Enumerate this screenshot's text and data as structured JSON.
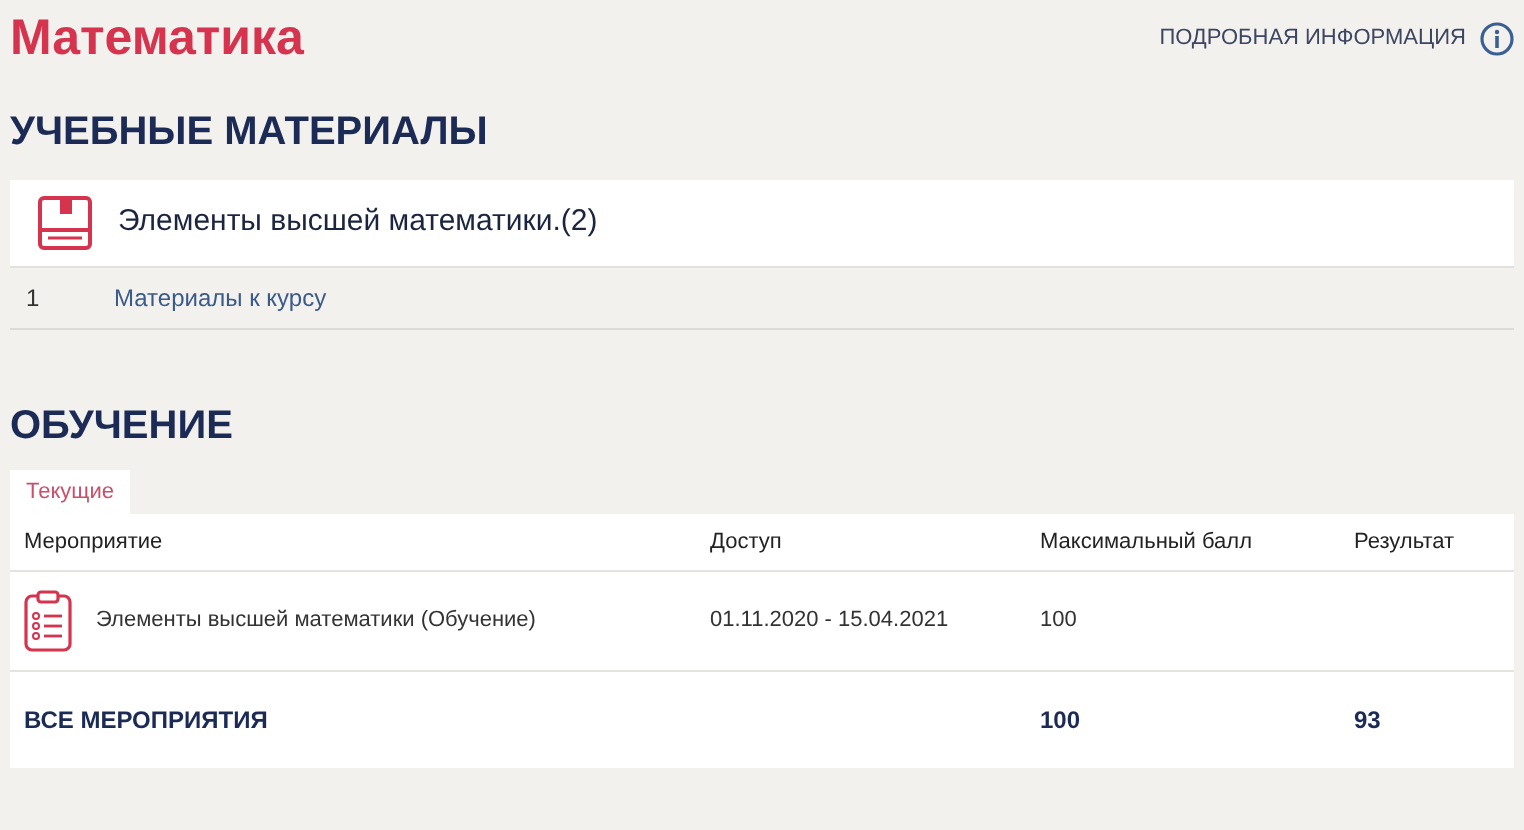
{
  "title": "Математика",
  "info_link": "ПОДРОБНАЯ ИНФОРМАЦИЯ",
  "materials": {
    "heading": "УЧЕБНЫЕ МАТЕРИАЛЫ",
    "course": "Элементы высшей математики.(2)",
    "items": [
      {
        "number": "1",
        "label": "Материалы к курсу"
      }
    ]
  },
  "training": {
    "heading": "ОБУЧЕНИЕ",
    "tabs": [
      {
        "label": "Текущие",
        "selected": true
      }
    ],
    "columns": [
      "Мероприятие",
      "Доступ",
      "Максимальный балл",
      "Результат"
    ],
    "rows": [
      {
        "event": "Элементы высшей математики (Обучение)",
        "access": "01.11.2020 - 15.04.2021",
        "max_score": "100"
      }
    ],
    "total": {
      "label": "ВСЕ МЕРОПРИЯТИЯ",
      "max_score": "100",
      "result": "93"
    }
  }
}
